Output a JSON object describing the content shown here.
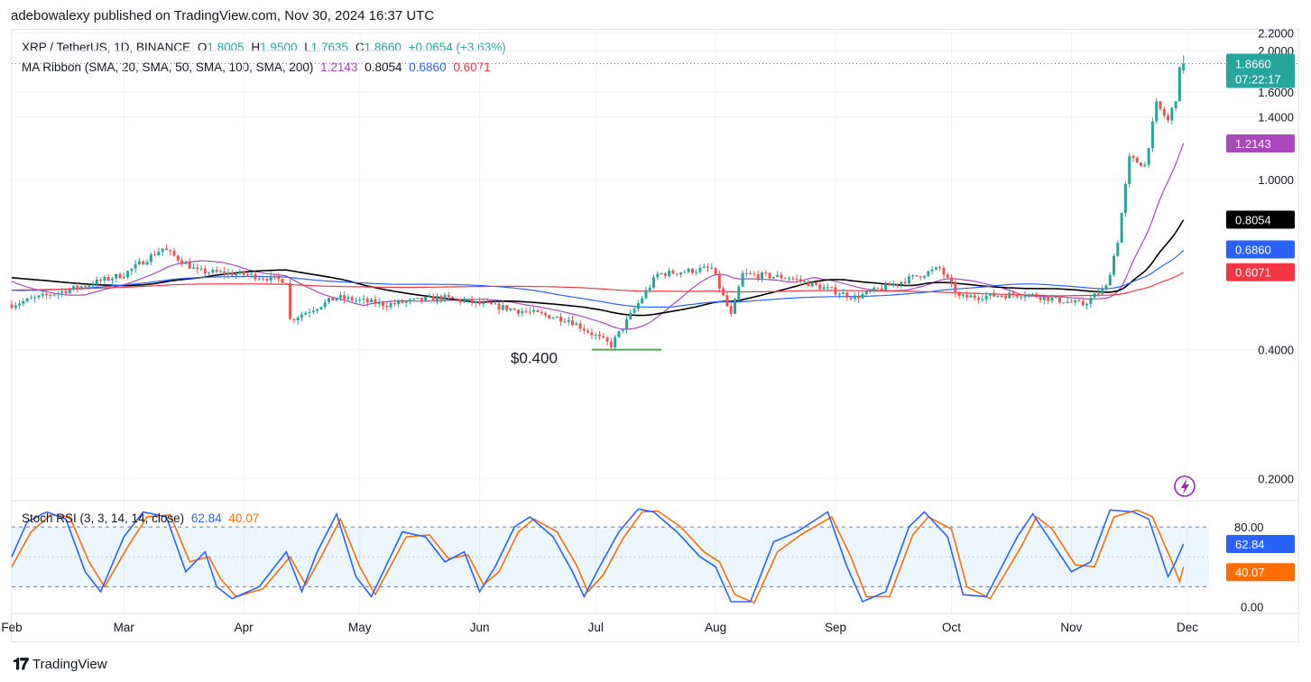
{
  "header": {
    "published": "adebowalexy published on TradingView.com, Nov 30, 2024 16:37 UTC"
  },
  "legend": {
    "symbol": "XRP / TetherUS, 1D, BINANCE",
    "o_label": "O",
    "o_value": "1.8005",
    "h_label": "H",
    "h_value": "1.9500",
    "l_label": "L",
    "l_value": "1.7635",
    "c_label": "C",
    "c_value": "1.8660",
    "change": "+0.0654 (+3.63%)",
    "ma_label": "MA Ribbon (SMA, 20, SMA, 50, SMA, 100, SMA, 200)",
    "ma20": "1.2143",
    "ma50": "0.8054",
    "ma100": "0.6860",
    "ma200": "0.6071"
  },
  "colors": {
    "up": "#26a69a",
    "down": "#ef5350",
    "ma20": "#ab47bc",
    "ma50": "#000000",
    "ma100": "#2962ff",
    "ma200": "#f23645",
    "rsi_k": "#2962ff",
    "rsi_d": "#ff6d00",
    "support": "#4caf50",
    "lightning": "#9c27b0"
  },
  "price_badge": {
    "price": "1.8660",
    "countdown": "07:22:17"
  },
  "annotation": {
    "support_label": "$0.400"
  },
  "stoch": {
    "label": "Stoch RSI (3, 3, 14, 14, close)",
    "k": "62.84",
    "d": "40.07",
    "ticks": [
      "80.00",
      "0.00"
    ]
  },
  "footer": {
    "brand": "TradingView"
  },
  "chart_data": [
    {
      "type": "candlestick",
      "title": "XRP / TetherUS, 1D, BINANCE",
      "y_scale": "log",
      "ylim": [
        0.18,
        2.25
      ],
      "y_ticks": [
        "2.2000",
        "2.0000",
        "1.6000",
        "1.4000",
        "1.0000",
        "0.4000",
        "0.2000"
      ],
      "x_ticks": [
        "Feb",
        "Mar",
        "Apr",
        "May",
        "Jun",
        "Jul",
        "Aug",
        "Sep",
        "Oct",
        "Nov",
        "Dec"
      ],
      "ohlc_anchors": [
        [
          "2024-02-01",
          0.51
        ],
        [
          "2024-02-15",
          0.55
        ],
        [
          "2024-03-01",
          0.6
        ],
        [
          "2024-03-11",
          0.69
        ],
        [
          "2024-03-20",
          0.61
        ],
        [
          "2024-04-01",
          0.6
        ],
        [
          "2024-04-12",
          0.58
        ],
        [
          "2024-04-13",
          0.47
        ],
        [
          "2024-04-25",
          0.53
        ],
        [
          "2024-05-08",
          0.51
        ],
        [
          "2024-05-22",
          0.53
        ],
        [
          "2024-06-08",
          0.5
        ],
        [
          "2024-06-24",
          0.47
        ],
        [
          "2024-07-05",
          0.41
        ],
        [
          "2024-07-13",
          0.53
        ],
        [
          "2024-07-17",
          0.6
        ],
        [
          "2024-07-31",
          0.62
        ],
        [
          "2024-08-05",
          0.48
        ],
        [
          "2024-08-08",
          0.6
        ],
        [
          "2024-08-20",
          0.59
        ],
        [
          "2024-09-06",
          0.53
        ],
        [
          "2024-09-28",
          0.62
        ],
        [
          "2024-10-03",
          0.53
        ],
        [
          "2024-10-20",
          0.54
        ],
        [
          "2024-11-04",
          0.51
        ],
        [
          "2024-11-10",
          0.56
        ],
        [
          "2024-11-13",
          0.72
        ],
        [
          "2024-11-16",
          1.12
        ],
        [
          "2024-11-20",
          1.08
        ],
        [
          "2024-11-23",
          1.5
        ],
        [
          "2024-11-26",
          1.37
        ],
        [
          "2024-11-28",
          1.55
        ],
        [
          "2024-11-29",
          1.8
        ],
        [
          "2024-11-30",
          1.866
        ]
      ],
      "last_candle": {
        "date": "2024-11-30",
        "open": 1.8005,
        "high": 1.95,
        "low": 1.7635,
        "close": 1.866
      },
      "series": [
        {
          "name": "SMA 20",
          "last": 1.2143
        },
        {
          "name": "SMA 50",
          "last": 0.8054
        },
        {
          "name": "SMA 100",
          "last": 0.686
        },
        {
          "name": "SMA 200",
          "last": 0.6071
        }
      ],
      "annotations": [
        {
          "text": "$0.400",
          "y": 0.4,
          "x_from": "2024-06-30",
          "x_to": "2024-07-18"
        }
      ]
    },
    {
      "type": "line",
      "title": "Stoch RSI (3, 3, 14, 14, close)",
      "ylim": [
        -5,
        100
      ],
      "y_ticks": [
        "80.00",
        "0.00"
      ],
      "band": [
        20,
        80
      ],
      "series": [
        {
          "name": "K",
          "last": 62.84
        },
        {
          "name": "D",
          "last": 40.07
        }
      ],
      "k_path": [
        [
          "2024-02-01",
          50
        ],
        [
          "2024-02-05",
          85
        ],
        [
          "2024-02-10",
          95
        ],
        [
          "2024-02-15",
          88
        ],
        [
          "2024-02-20",
          35
        ],
        [
          "2024-02-24",
          15
        ],
        [
          "2024-03-01",
          70
        ],
        [
          "2024-03-06",
          95
        ],
        [
          "2024-03-12",
          90
        ],
        [
          "2024-03-17",
          35
        ],
        [
          "2024-03-22",
          55
        ],
        [
          "2024-03-25",
          20
        ],
        [
          "2024-03-29",
          8
        ],
        [
          "2024-04-05",
          20
        ],
        [
          "2024-04-12",
          55
        ],
        [
          "2024-04-16",
          15
        ],
        [
          "2024-04-20",
          55
        ],
        [
          "2024-04-25",
          93
        ],
        [
          "2024-04-30",
          30
        ],
        [
          "2024-05-04",
          10
        ],
        [
          "2024-05-12",
          75
        ],
        [
          "2024-05-18",
          70
        ],
        [
          "2024-05-23",
          45
        ],
        [
          "2024-05-28",
          55
        ],
        [
          "2024-06-01",
          15
        ],
        [
          "2024-06-05",
          40
        ],
        [
          "2024-06-10",
          80
        ],
        [
          "2024-06-14",
          90
        ],
        [
          "2024-06-20",
          70
        ],
        [
          "2024-06-25",
          35
        ],
        [
          "2024-06-28",
          10
        ],
        [
          "2024-07-02",
          40
        ],
        [
          "2024-07-07",
          75
        ],
        [
          "2024-07-12",
          98
        ],
        [
          "2024-07-16",
          95
        ],
        [
          "2024-07-22",
          75
        ],
        [
          "2024-07-28",
          50
        ],
        [
          "2024-08-01",
          40
        ],
        [
          "2024-08-05",
          5
        ],
        [
          "2024-08-10",
          5
        ],
        [
          "2024-08-16",
          65
        ],
        [
          "2024-08-22",
          75
        ],
        [
          "2024-08-30",
          95
        ],
        [
          "2024-09-04",
          40
        ],
        [
          "2024-09-08",
          5
        ],
        [
          "2024-09-14",
          15
        ],
        [
          "2024-09-20",
          80
        ],
        [
          "2024-09-24",
          95
        ],
        [
          "2024-09-30",
          70
        ],
        [
          "2024-10-04",
          12
        ],
        [
          "2024-10-10",
          10
        ],
        [
          "2024-10-18",
          70
        ],
        [
          "2024-10-22",
          93
        ],
        [
          "2024-10-26",
          70
        ],
        [
          "2024-11-01",
          35
        ],
        [
          "2024-11-06",
          45
        ],
        [
          "2024-11-11",
          97
        ],
        [
          "2024-11-17",
          95
        ],
        [
          "2024-11-21",
          88
        ],
        [
          "2024-11-26",
          30
        ],
        [
          "2024-11-28",
          45
        ],
        [
          "2024-11-30",
          62.84
        ]
      ],
      "d_path": [
        [
          "2024-02-01",
          40
        ],
        [
          "2024-02-06",
          75
        ],
        [
          "2024-02-11",
          92
        ],
        [
          "2024-02-16",
          90
        ],
        [
          "2024-02-21",
          45
        ],
        [
          "2024-02-25",
          20
        ],
        [
          "2024-03-02",
          60
        ],
        [
          "2024-03-07",
          90
        ],
        [
          "2024-03-13",
          92
        ],
        [
          "2024-03-18",
          45
        ],
        [
          "2024-03-23",
          50
        ],
        [
          "2024-03-26",
          28
        ],
        [
          "2024-03-30",
          10
        ],
        [
          "2024-04-06",
          18
        ],
        [
          "2024-04-13",
          50
        ],
        [
          "2024-04-17",
          22
        ],
        [
          "2024-04-21",
          50
        ],
        [
          "2024-04-26",
          88
        ],
        [
          "2024-05-01",
          40
        ],
        [
          "2024-05-05",
          12
        ],
        [
          "2024-05-13",
          70
        ],
        [
          "2024-05-19",
          72
        ],
        [
          "2024-05-24",
          48
        ],
        [
          "2024-05-29",
          52
        ],
        [
          "2024-06-02",
          22
        ],
        [
          "2024-06-06",
          35
        ],
        [
          "2024-06-11",
          75
        ],
        [
          "2024-06-15",
          88
        ],
        [
          "2024-06-21",
          75
        ],
        [
          "2024-06-26",
          42
        ],
        [
          "2024-06-29",
          15
        ],
        [
          "2024-07-03",
          32
        ],
        [
          "2024-07-08",
          68
        ],
        [
          "2024-07-13",
          95
        ],
        [
          "2024-07-17",
          96
        ],
        [
          "2024-07-23",
          80
        ],
        [
          "2024-07-29",
          55
        ],
        [
          "2024-08-02",
          45
        ],
        [
          "2024-08-06",
          12
        ],
        [
          "2024-08-11",
          4
        ],
        [
          "2024-08-17",
          55
        ],
        [
          "2024-08-23",
          72
        ],
        [
          "2024-08-31",
          90
        ],
        [
          "2024-09-05",
          50
        ],
        [
          "2024-09-09",
          10
        ],
        [
          "2024-09-15",
          10
        ],
        [
          "2024-09-21",
          72
        ],
        [
          "2024-09-25",
          90
        ],
        [
          "2024-10-01",
          78
        ],
        [
          "2024-10-05",
          20
        ],
        [
          "2024-10-11",
          8
        ],
        [
          "2024-10-19",
          60
        ],
        [
          "2024-10-23",
          90
        ],
        [
          "2024-10-27",
          78
        ],
        [
          "2024-11-02",
          42
        ],
        [
          "2024-11-07",
          40
        ],
        [
          "2024-11-12",
          90
        ],
        [
          "2024-11-18",
          97
        ],
        [
          "2024-11-22",
          90
        ],
        [
          "2024-11-27",
          45
        ],
        [
          "2024-11-29",
          25
        ],
        [
          "2024-11-30",
          40.07
        ]
      ]
    }
  ]
}
